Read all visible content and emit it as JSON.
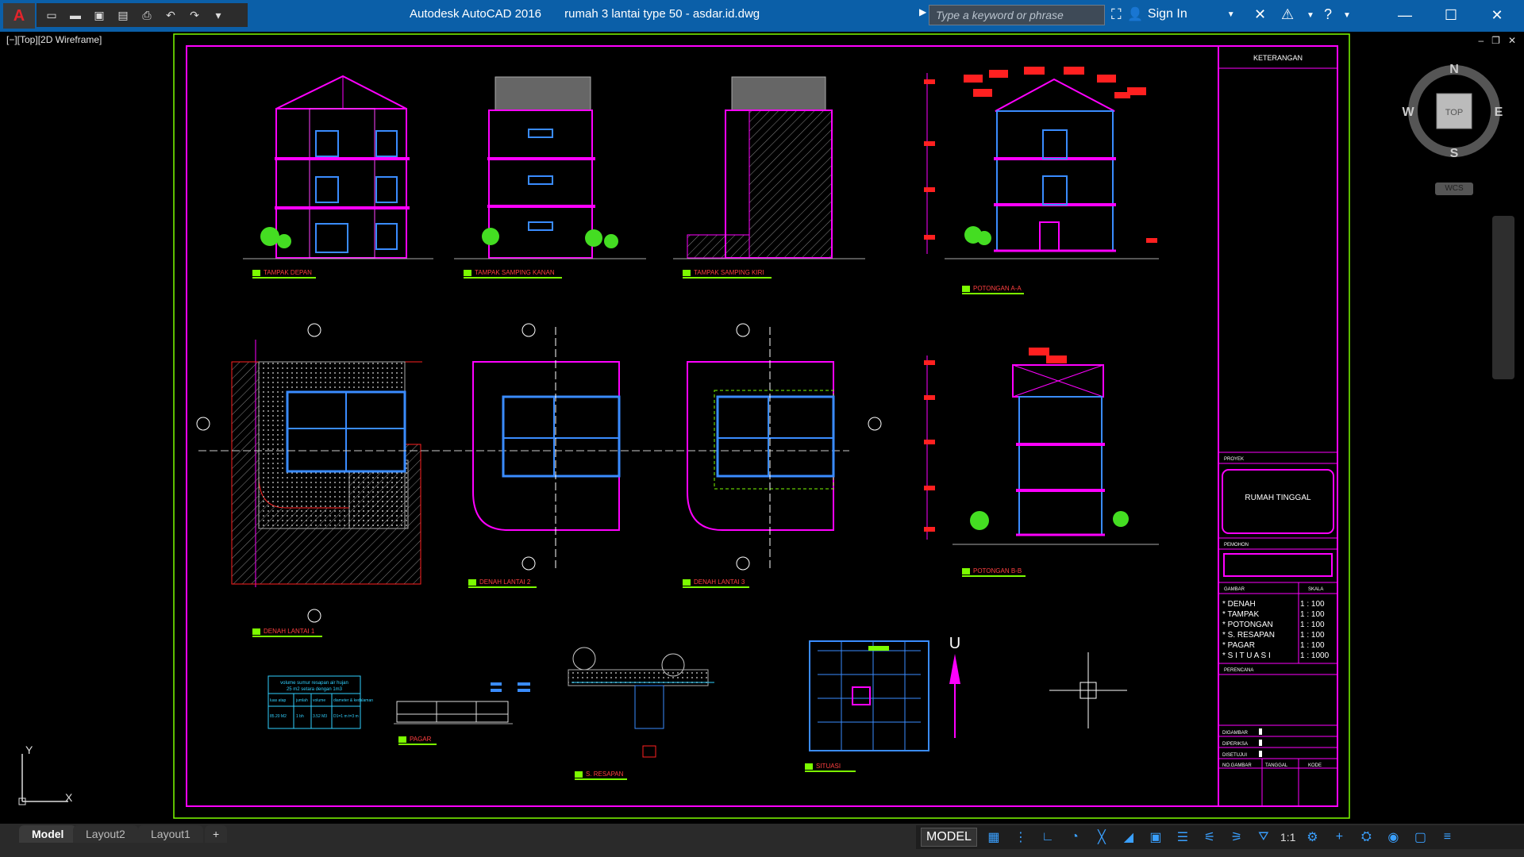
{
  "titlebar": {
    "app": "Autodesk AutoCAD 2016",
    "file": "rumah 3 lantai type 50 - asdar.id.dwg",
    "search_placeholder": "Type a keyword or phrase",
    "signin": "Sign In"
  },
  "viewport": {
    "label": "[−][Top][2D Wireframe]"
  },
  "navcube": {
    "n": "N",
    "s": "S",
    "e": "E",
    "w": "W",
    "face": "TOP",
    "wcs": "WCS"
  },
  "ucs": {
    "x": "X",
    "y": "Y"
  },
  "tabs": [
    {
      "label": "Model"
    },
    {
      "label": "Layout2"
    },
    {
      "label": "Layout1"
    }
  ],
  "add_tab": "+",
  "status": {
    "model": "MODEL",
    "scale": "1:1"
  },
  "drawing": {
    "views": {
      "front": "TAMPAK DEPAN",
      "right": "TAMPAK SAMPING KANAN",
      "left": "TAMPAK SAMPING KIRI",
      "section_a": "POTONGAN A-A",
      "section_b": "POTONGAN B-B",
      "plan1": "DENAH LANTAI 1",
      "plan2": "DENAH LANTAI 2",
      "plan3": "DENAH LANTAI 3",
      "fence": "PAGAR",
      "infiltration": "S. RESAPAN",
      "site": "SITUASI",
      "north": "U"
    },
    "volume_table": {
      "title1": "volume sumur resapan air hujan",
      "title2": "25 m2 setara dengan 1m3",
      "headers": [
        "luas atap",
        "jumlah",
        "volume",
        "diameter & kedalaman"
      ],
      "row": [
        "85.20 M2",
        "1 bh",
        "3.52 M3",
        "D1=1 m t=3 m"
      ]
    },
    "titleblock": {
      "keterangan": "KETERANGAN",
      "proyek": "PROYEK",
      "project_name": "RUMAH TINGGAL",
      "pemohon": "PEMOHON",
      "gambar": "GAMBAR",
      "skala": "SKALA",
      "items": [
        {
          "name": "* DENAH",
          "scale": "1 : 100"
        },
        {
          "name": "* TAMPAK",
          "scale": "1 : 100"
        },
        {
          "name": "* POTONGAN",
          "scale": "1 : 100"
        },
        {
          "name": "* S. RESAPAN",
          "scale": "1 : 100"
        },
        {
          "name": "* PAGAR",
          "scale": "1 : 100"
        },
        {
          "name": "* S I T U A S I",
          "scale": "1 : 1000"
        }
      ],
      "perencana": "PERENCANA",
      "digambar": "DIGAMBAR",
      "diperiksa": "DIPERIKSA",
      "disetujui": "DISETUJUI",
      "no_gambar": "NO.GAMBAR",
      "tanggal": "TANGGAL",
      "kode": "KODE"
    }
  },
  "colors": {
    "titlebar": "#0b5fa8",
    "frame": "#ff00ff",
    "border": "#7cfc00",
    "red": "#ff2020",
    "blue": "#3a8cff",
    "cyan": "#30d0ff",
    "green": "#44dd22"
  }
}
